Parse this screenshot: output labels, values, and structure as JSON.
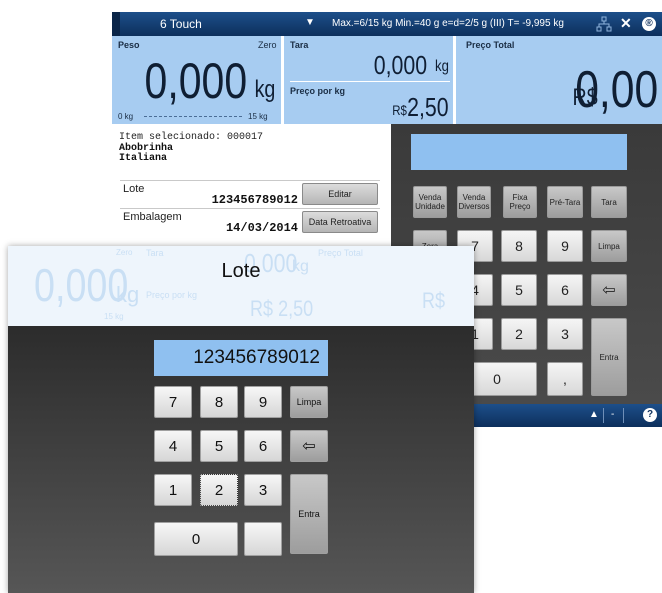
{
  "titlebar": {
    "scale_name": "6 Touch",
    "dropdown_icon": "▼",
    "info": "Max.=6/15 kg   Min.=40 g   e=d=2/5 g   (III)   T= -9,995 kg",
    "close_icon": "✕",
    "logo_icon": "®"
  },
  "peso": {
    "label": "Peso",
    "zero_label": "Zero",
    "value": "0,000",
    "unit": "kg",
    "range_min": "0 kg",
    "range_max": "15 kg"
  },
  "tara": {
    "label": "Tara",
    "value": "0,000",
    "unit": "kg"
  },
  "preco_kg": {
    "label": "Preço por kg",
    "currency": "R$",
    "value": "2,50"
  },
  "preco_total": {
    "label": "Preço Total",
    "currency": "R$",
    "value": "0,00"
  },
  "item": {
    "selected_label": "Item selecionado: 000017",
    "name_line1": "Abobrinha",
    "name_line2": "Italiana"
  },
  "fields": [
    {
      "label": "Lote",
      "value": "123456789012",
      "button": "Editar"
    },
    {
      "label": "Embalagem",
      "value": "14/03/2014",
      "button": "Data Retroativa"
    }
  ],
  "bg_keypad": {
    "func_keys": [
      "Venda Unidade",
      "Venda Diversos",
      "Fixa Preço",
      "Pré-Tara",
      "Tara"
    ],
    "zera": "Zera",
    "digits": [
      "7",
      "8",
      "9",
      "4",
      "5",
      "6",
      "1",
      "2",
      "3",
      "0",
      ","
    ],
    "limpa": "Limpa",
    "entra": "Entra",
    "backspace_icon": "⇦"
  },
  "bottombar": {
    "up_icon": "▲",
    "minus": "-",
    "help_icon": "?"
  },
  "dialog": {
    "title": "Lote",
    "value": "123456789012",
    "keys": [
      "7",
      "8",
      "9",
      "4",
      "5",
      "6",
      "1",
      "2",
      "3",
      "0"
    ],
    "limpa": "Limpa",
    "entra": "Entra",
    "backspace_icon": "⇦",
    "ghost": {
      "peso": "0,000",
      "peso_unit": "kg",
      "zero": "Zero",
      "tara": "Tara",
      "tara_value": "0,000",
      "tara_unit": "kg",
      "preco_kg": "Preço por kg",
      "preco_kg_value": "R$ 2,50",
      "preco_total": "Preço Total",
      "total_currency": "R$",
      "scale_max": "15 kg"
    }
  },
  "colors": {
    "titlebar": "#0d2f5c",
    "panel": "#a7ccf1",
    "display": "#8fc0f0",
    "keypad_bg": "#3a3a3a"
  }
}
